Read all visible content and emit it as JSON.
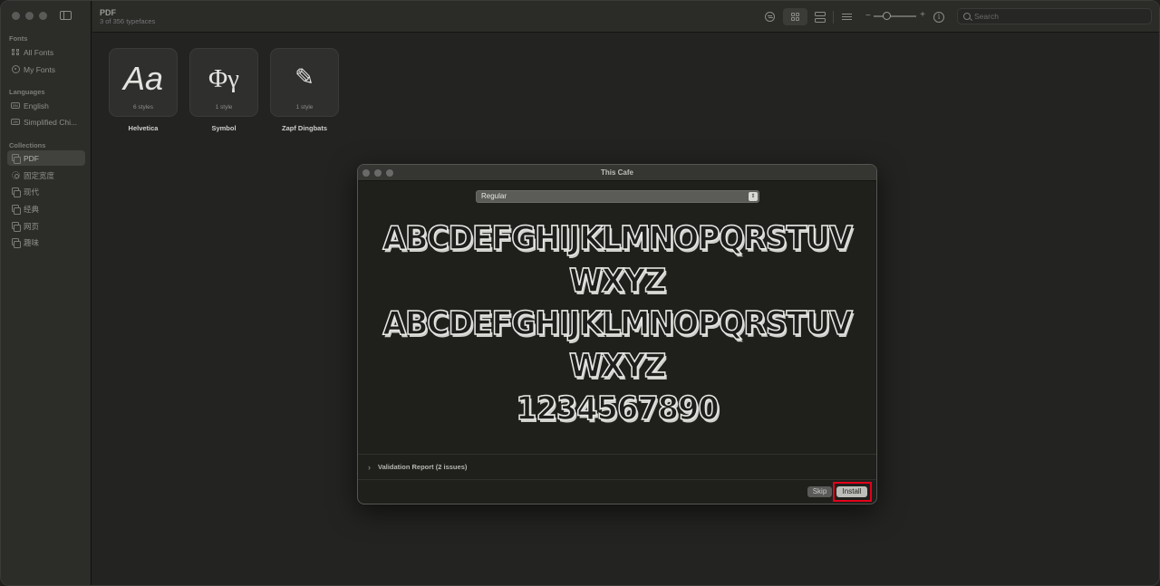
{
  "sidebar": {
    "sections": [
      {
        "title": "Fonts",
        "items": [
          {
            "label": "All Fonts",
            "icon": "grid-icon"
          },
          {
            "label": "My Fonts",
            "icon": "person-icon"
          }
        ]
      },
      {
        "title": "Languages",
        "items": [
          {
            "label": "English",
            "icon": "en-badge-icon",
            "badge": "EN"
          },
          {
            "label": "Simplified Chi...",
            "icon": "zh-badge-icon",
            "badge": "ZH"
          }
        ]
      },
      {
        "title": "Collections",
        "items": [
          {
            "label": "PDF",
            "icon": "collection-icon",
            "active": true
          },
          {
            "label": "固定宽度",
            "icon": "gear-icon"
          },
          {
            "label": "现代",
            "icon": "collection-icon"
          },
          {
            "label": "经典",
            "icon": "collection-icon"
          },
          {
            "label": "网页",
            "icon": "collection-icon"
          },
          {
            "label": "趣味",
            "icon": "collection-icon"
          }
        ]
      }
    ]
  },
  "toolbar": {
    "title": "PDF",
    "subtitle": "3 of 356 typefaces",
    "view_mode": "grid",
    "zoom_level": 0.3,
    "search_placeholder": "Search",
    "search_value": ""
  },
  "fonts": [
    {
      "name": "Helvetica",
      "sample": "Aa",
      "styles": "6 styles"
    },
    {
      "name": "Symbol",
      "sample": "Φγ",
      "styles": "1 style"
    },
    {
      "name": "Zapf Dingbats",
      "sample": "✎",
      "styles": "1 style"
    }
  ],
  "dialog": {
    "title": "This Cafe",
    "style_selected": "Regular",
    "preview_lines": [
      "ABCDEFGHIJKLMNOPQRSTUV",
      "WXYZ",
      "ABCDEFGHIJKLMNOPQRSTUV",
      "WXYZ",
      "1234567890"
    ],
    "validation_label": "Validation Report (2 issues)",
    "skip_label": "Skip",
    "install_label": "Install",
    "highlight_color": "#e3001b"
  }
}
